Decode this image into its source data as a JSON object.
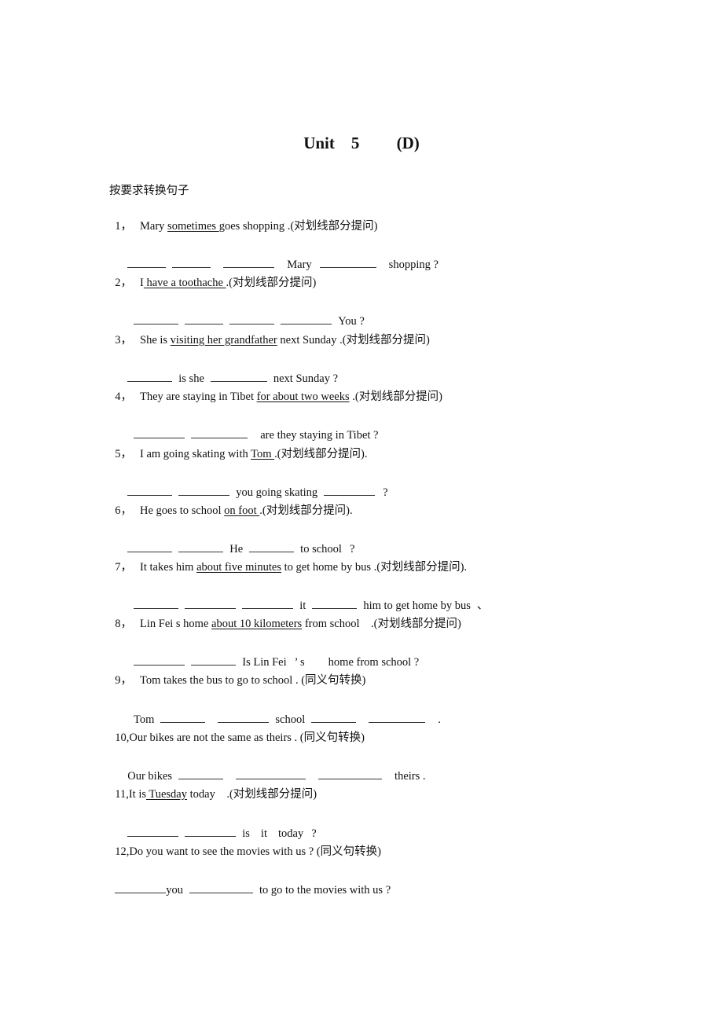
{
  "title": "Unit    5         (D)",
  "instruction": "按要求转换句子",
  "questions": [
    {
      "num": "1，",
      "parts": [
        "Mary ",
        "sometimes ",
        "goes shopping .(对划线部分提问)"
      ],
      "answer": [
        "",
        "",
        "",
        "Mary",
        "",
        "shopping ?"
      ]
    },
    {
      "num": "2，",
      "parts": [
        "I",
        " have a toothache ",
        ".(对划线部分提问)"
      ],
      "answer": [
        "",
        "",
        "",
        "",
        "You ?"
      ]
    },
    {
      "num": "3，",
      "parts": [
        "She is ",
        "visiting her grandfather",
        " next Sunday .(对划线部分提问)"
      ],
      "answer": [
        "",
        "is she",
        "",
        "next Sunday ?"
      ]
    },
    {
      "num": "4，",
      "parts": [
        "They are staying in Tibet ",
        "for about two weeks",
        " .(对划线部分提问)"
      ],
      "answer": [
        "",
        "",
        "are they staying in Tibet ?"
      ]
    },
    {
      "num": "5，",
      "parts": [
        "I am going skating with ",
        "Tom ",
        ".(对划线部分提问)."
      ],
      "answer": [
        "",
        "",
        "you going skating",
        "",
        "?"
      ]
    },
    {
      "num": "6，",
      "parts": [
        "He goes to school ",
        "on foot ",
        ".(对划线部分提问)."
      ],
      "answer": [
        "",
        "",
        "He",
        "",
        "to school",
        "?"
      ]
    },
    {
      "num": "7，",
      "parts": [
        "It takes him ",
        "about five minutes",
        " to get home by bus .(对划线部分提问)."
      ],
      "answer": [
        "",
        "",
        "",
        "it",
        "",
        "him to get home by bus",
        "、"
      ]
    },
    {
      "num": "8，",
      "parts": [
        "Lin Fei s home ",
        "about 10 kilometers",
        " from school    .(对划线部分提问)"
      ],
      "answer": [
        "",
        "",
        "Is Lin Fei",
        "’ s",
        "home from school ?"
      ]
    },
    {
      "num": "9，",
      "parts": [
        "Tom takes the bus to go to school . (同义句转换)"
      ],
      "answer": [
        "Tom",
        "",
        "",
        "school",
        "",
        "",
        "."
      ]
    },
    {
      "num": "10,",
      "parts": [
        "Our bikes are not the same as theirs . (同义句转换)"
      ],
      "answer": [
        "Our bikes",
        "",
        "",
        "",
        "theirs ."
      ]
    },
    {
      "num": "11,",
      "parts": [
        "It is",
        " Tuesday",
        " today    .(对划线部分提问)"
      ],
      "answer": [
        "",
        "",
        "is",
        "it",
        "today",
        "?"
      ]
    },
    {
      "num": "12,",
      "parts": [
        "Do you want to see the movies with us ? (同义句转换)"
      ],
      "answer": [
        "",
        "you",
        "",
        "to go to the movies with us ?"
      ]
    }
  ]
}
